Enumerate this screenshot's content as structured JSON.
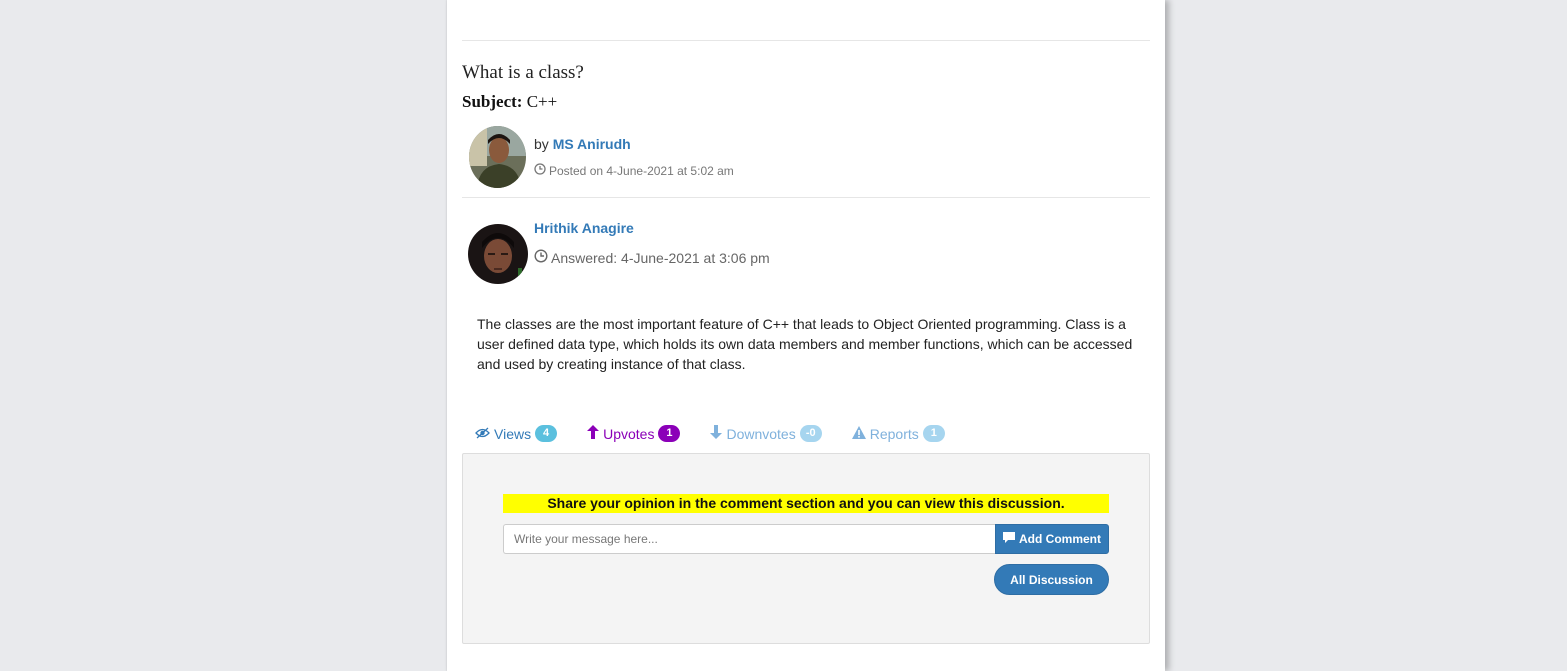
{
  "question": {
    "title": "What is a class?",
    "subject_label": "Subject:",
    "subject_value": "C++",
    "by_prefix": "by",
    "author": "MS Anirudh",
    "posted": "Posted on 4-June-2021 at 5:02 am"
  },
  "answer": {
    "author": "Hrithik Anagire",
    "date": "Answered: 4-June-2021 at 3:06 pm",
    "text": "The classes are the most important feature of C++ that leads to Object Oriented programming. Class is a user defined data type, which holds its own data members and member functions, which can be accessed and used by creating instance of that class."
  },
  "stats": {
    "views_label": "Views",
    "views_count": "4",
    "upvotes_label": "Upvotes",
    "upvotes_count": "1",
    "downvotes_label": "Downvotes",
    "downvotes_count": "-0",
    "reports_label": "Reports",
    "reports_count": "1"
  },
  "comment": {
    "notice": "Share your opinion in the comment section and you can view this discussion.",
    "placeholder": "Write your message here...",
    "add_button": "Add Comment",
    "all_button": "All Discussion"
  },
  "icons": {
    "clock": "clock-icon",
    "eye": "eye-icon",
    "up": "arrow-up-icon",
    "down": "arrow-down-icon",
    "warn": "warning-icon",
    "comment": "comment-icon"
  },
  "colors": {
    "link": "#337ab7",
    "upvote": "#8b00b8",
    "notice_bg": "#ffff00",
    "button": "#337ab7"
  }
}
